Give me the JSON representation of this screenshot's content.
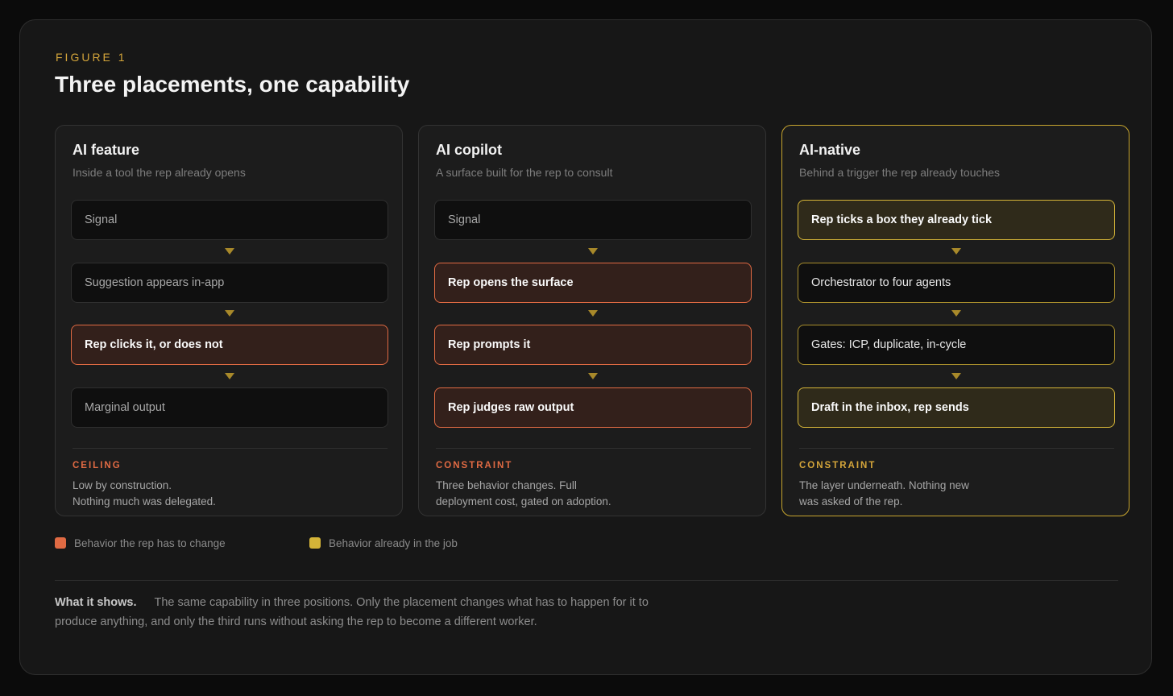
{
  "figure": {
    "eyebrow": "FIGURE 1",
    "title": "Three placements, one capability"
  },
  "cards": [
    {
      "title": "AI feature",
      "subtitle": "Inside a tool the rep already opens",
      "steps": [
        {
          "label": "Signal",
          "kind": "plain"
        },
        {
          "label": "Suggestion appears in-app",
          "kind": "plain"
        },
        {
          "label": "Rep clicks it, or does not",
          "kind": "change"
        },
        {
          "label": "Marginal output",
          "kind": "plain"
        }
      ],
      "footer_label": "CEILING",
      "footer_line1": "Low by construction.",
      "footer_line2": "Nothing much was delegated."
    },
    {
      "title": "AI copilot",
      "subtitle": "A surface built for the rep to consult",
      "steps": [
        {
          "label": "Signal",
          "kind": "plain"
        },
        {
          "label": "Rep opens the surface",
          "kind": "change"
        },
        {
          "label": "Rep prompts it",
          "kind": "change"
        },
        {
          "label": "Rep judges raw output",
          "kind": "change"
        }
      ],
      "footer_label": "CONSTRAINT",
      "footer_line1": "Three behavior changes. Full",
      "footer_line2": "deployment cost, gated on adoption."
    },
    {
      "title": "AI-native",
      "subtitle": "Behind a trigger the rep already touches",
      "steps": [
        {
          "label": "Rep ticks a box they already tick",
          "kind": "job"
        },
        {
          "label": "Orchestrator to four agents",
          "kind": "gold-outline"
        },
        {
          "label": "Gates: ICP, duplicate, in-cycle",
          "kind": "gold-outline"
        },
        {
          "label": "Draft in the inbox, rep sends",
          "kind": "job"
        }
      ],
      "footer_label": "CONSTRAINT",
      "footer_line1": "The layer underneath. Nothing new",
      "footer_line2": "was asked of the rep."
    }
  ],
  "legend": {
    "change": {
      "label": "Behavior the rep has to change",
      "color": "#e06a43"
    },
    "job": {
      "label": "Behavior already in the job",
      "color": "#d4b438"
    }
  },
  "what_it_shows": {
    "heading": "What it shows.",
    "text": "The same capability in three positions. Only the placement changes what has to happen for it to produce anything, and only the third runs without asking the rep to become a different worker."
  }
}
